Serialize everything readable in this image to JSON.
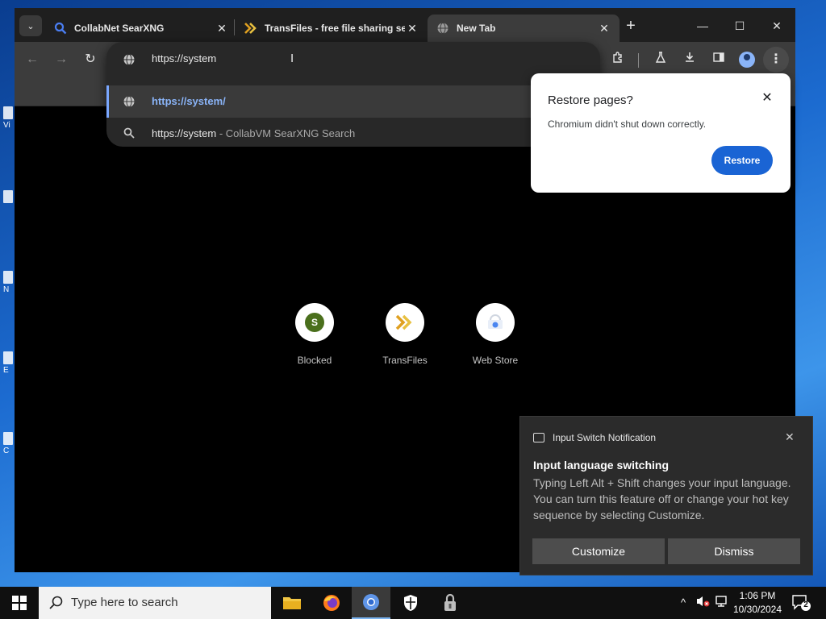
{
  "browser": {
    "tabs": [
      {
        "title": "CollabNet SearXNG",
        "icon": "searxng-magnifier-icon"
      },
      {
        "title": "TransFiles - free file sharing se",
        "icon": "transfiles-chevron-icon"
      },
      {
        "title": "New Tab",
        "icon": "globe-icon",
        "active": true
      }
    ],
    "tab_search_glyph": "⌄",
    "newtab_glyph": "+",
    "window_controls": {
      "minimize": "—",
      "maximize": "☐",
      "close": "✕"
    },
    "nav": {
      "back": "←",
      "forward": "→",
      "reload": "↻"
    },
    "omnibox": {
      "value": "https://system",
      "suggestions": [
        {
          "text": "https://system/",
          "description": "",
          "icon": "globe-icon"
        },
        {
          "text": "https://system",
          "description": "- CollabVM SearXNG Search",
          "icon": "search-icon"
        }
      ]
    },
    "toolbar_icons": [
      "extensions-icon",
      "labs-flask-icon",
      "download-icon",
      "side-panel-icon",
      "profile-icon",
      "menu-icon"
    ],
    "menu_glyph": "⋮"
  },
  "restore_popup": {
    "title": "Restore pages?",
    "message": "Chromium didn't shut down correctly.",
    "button": "Restore",
    "close_glyph": "✕"
  },
  "shortcuts": [
    {
      "name": "Blocked",
      "letter": "S",
      "color": "#4a6f1c"
    },
    {
      "name": "TransFiles"
    },
    {
      "name": "Web Store"
    }
  ],
  "toast": {
    "header": "Input Switch Notification",
    "close_glyph": "✕",
    "title": "Input language switching",
    "body": "Typing Left Alt + Shift changes your input language. You can turn this feature off or change your hot key sequence by selecting Customize.",
    "customize": "Customize",
    "dismiss": "Dismiss"
  },
  "taskbar": {
    "search_placeholder": "Type here to search",
    "time": "1:06 PM",
    "date": "10/30/2024",
    "notification_count": "2",
    "apps": [
      "file-explorer-icon",
      "firefox-icon",
      "chromium-icon",
      "security-shield-icon",
      "vpn-lock-icon"
    ]
  },
  "desktop_icons": [
    "Vi",
    "",
    "N",
    "E",
    "C"
  ],
  "colors": {
    "accent": "#1a64d4",
    "link": "#8ab4f8",
    "taskbar": "#101010"
  }
}
